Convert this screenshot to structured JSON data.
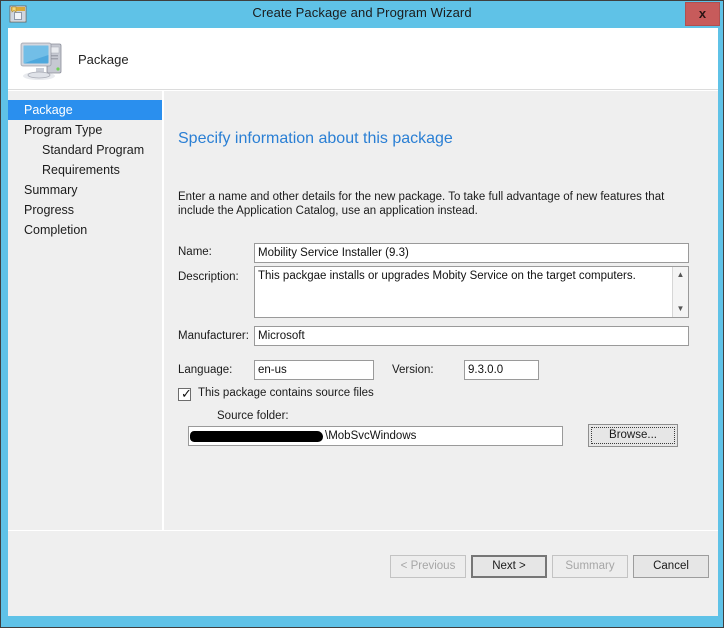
{
  "window": {
    "title": "Create Package and Program Wizard",
    "icon": "package-wizard-icon",
    "close_label": "x",
    "frame_color": "#5fc2e7"
  },
  "banner": {
    "title": "Package",
    "icon": "computer-icon"
  },
  "sidebar": {
    "items": [
      {
        "label": "Package",
        "indent": false,
        "selected": true
      },
      {
        "label": "Program Type",
        "indent": false,
        "selected": false
      },
      {
        "label": "Standard Program",
        "indent": true,
        "selected": false
      },
      {
        "label": "Requirements",
        "indent": true,
        "selected": false
      },
      {
        "label": "Summary",
        "indent": false,
        "selected": false
      },
      {
        "label": "Progress",
        "indent": false,
        "selected": false
      },
      {
        "label": "Completion",
        "indent": false,
        "selected": false
      }
    ],
    "selected_color": "#2a8fee"
  },
  "main": {
    "heading": "Specify information about this package",
    "heading_color": "#2a7fd4",
    "intro": "Enter a name and other details for the new package. To take full advantage of new features that include the Application Catalog, use an application instead.",
    "form": {
      "name_label": "Name:",
      "name_value": "Mobility Service Installer (9.3)",
      "description_label": "Description:",
      "description_value": "This packgae installs or upgrades Mobity Service on the target computers.",
      "manufacturer_label": "Manufacturer:",
      "manufacturer_value": "Microsoft",
      "language_label": "Language:",
      "language_value": "en-us",
      "version_label": "Version:",
      "version_value": "9.3.0.0",
      "source_checkbox_label": "This package contains source files",
      "source_checkbox_checked": true,
      "source_folder_label": "Source folder:",
      "source_folder_value": "\\MobSvcWindows",
      "browse_label": "Browse...",
      "scroll_up": "▲",
      "scroll_down": "▼",
      "check_glyph": "✓"
    }
  },
  "footer": {
    "buttons": [
      {
        "label": "< Previous",
        "state": "disabled"
      },
      {
        "label": "Next >",
        "state": "default"
      },
      {
        "label": "Summary",
        "state": "disabled"
      },
      {
        "label": "Cancel",
        "state": "normal"
      }
    ]
  }
}
